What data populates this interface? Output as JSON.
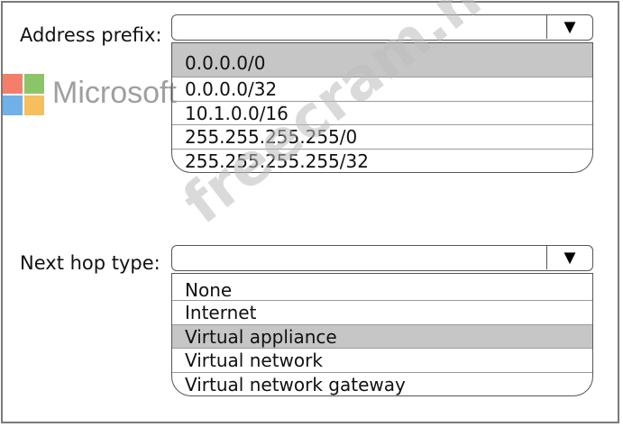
{
  "address_prefix": {
    "label": "Address prefix:",
    "arrow_icon": "▼",
    "options": [
      "0.0.0.0/0",
      "0.0.0.0/32",
      "10.1.0.0/16",
      "255.255.255.255/0",
      "255.255.255.255/32"
    ],
    "selected_index": 0
  },
  "next_hop_type": {
    "label": "Next hop type:",
    "arrow_icon": "▼",
    "options": [
      "None",
      "Internet",
      "Virtual appliance",
      "Virtual network",
      "Virtual network gateway"
    ],
    "selected_index": 2
  },
  "logo": {
    "text": "Microsoft",
    "colors": [
      "#f37f6b",
      "#8cc46a",
      "#6fb1e8",
      "#f6bf5e"
    ]
  },
  "watermark": {
    "text": "freecram.net"
  }
}
